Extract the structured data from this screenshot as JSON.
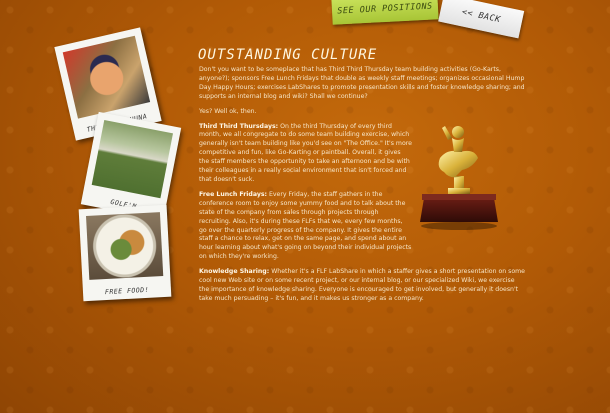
{
  "nav": {
    "positions_label": "SEE OUR POSITIONS",
    "back_label": "<< BACK"
  },
  "photos": [
    {
      "caption": "THE BIG KAHUNA"
    },
    {
      "caption": "GOLF'N"
    },
    {
      "caption": "FREE FOOD!"
    }
  ],
  "page": {
    "title": "OUTSTANDING CULTURE",
    "intro": "Don't you want to be someplace that has Third Third Thursday team building activities (Go-Karts, anyone?); sponsors Free Lunch Fridays that double as weekly staff meetings; organizes occasional Hump Day Happy Hours; exercises LabShares to promote presentation skills and foster knowledge sharing; and supports an internal blog and wiki? Shall we continue?",
    "yes": "Yes? Well ok, then.",
    "sections": [
      {
        "heading": "Third Third Thursdays:",
        "body": "On the third Thursday of every third month, we all congregate to do some team building exercise, which generally isn't team building like you'd see on \"The Office.\" It's more competitive and fun, like Go-Karting or paintball. Overall, it gives the staff members the opportunity to take an afternoon and be with their colleagues in a really social environment that isn't forced and that doesn't suck."
      },
      {
        "heading": "Free Lunch Fridays:",
        "body": "Every Friday, the staff gathers in the conference room to enjoy some yummy food and to talk about the state of the company from sales through projects through recruiting. Also, it's during these FLFs that we, every few months, go over the quarterly progress of the company. It gives the entire staff a chance to relax, get on the same page, and spend about an hour learning about what's going on beyond their individual projects on which they're working."
      },
      {
        "heading": "Knowledge Sharing:",
        "body": "Whether it's a FLF LabShare in which a staffer gives a short presentation on some cool new Web site or on some recent project, or our internal blog, or our specialized Wiki, we exercise the importance of knowledge sharing. Everyone is encouraged to get involved, but generally it doesn't take much persuading – it's fun, and it makes us stronger as a company."
      }
    ]
  }
}
